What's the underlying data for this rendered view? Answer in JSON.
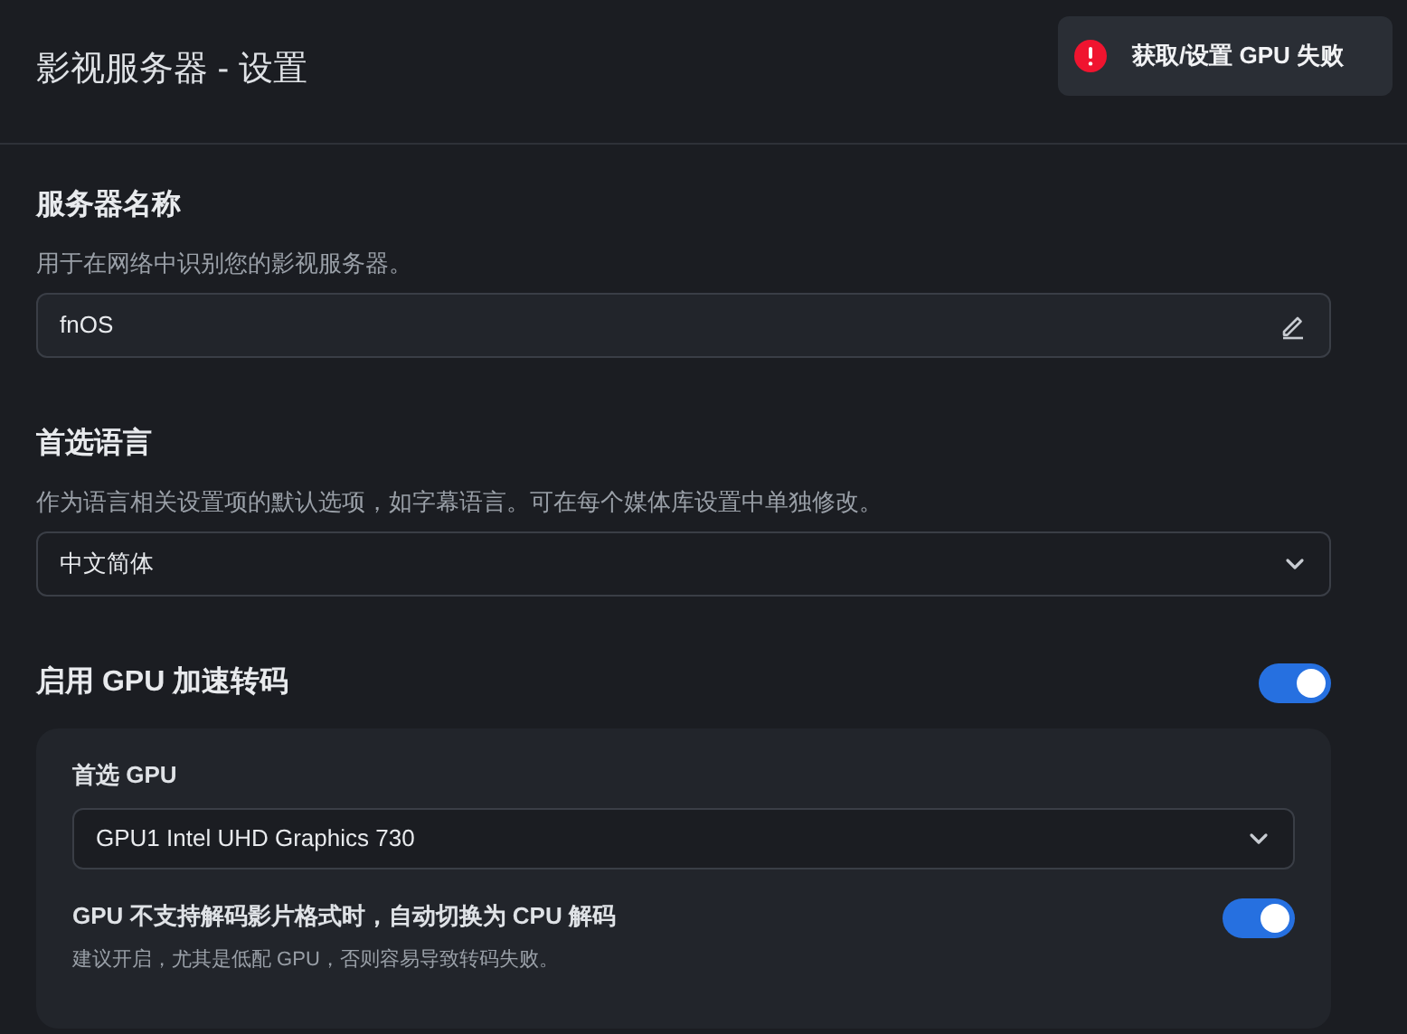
{
  "header": {
    "title": "影视服务器 - 设置"
  },
  "toast": {
    "message": "获取/设置 GPU 失败"
  },
  "sections": [
    {
      "kind": "text_input",
      "title": "服务器名称",
      "description": "用于在网络中识别您的影视服务器。",
      "value": "fnOS"
    },
    {
      "kind": "select",
      "title": "首选语言",
      "description": "作为语言相关设置项的默认选项，如字幕语言。可在每个媒体库设置中单独修改。",
      "value": "中文简体"
    },
    {
      "kind": "toggle",
      "title": "启用 GPU 加速转码",
      "on": true,
      "panel": {
        "label": "首选 GPU",
        "select_value": "GPU1 Intel UHD Graphics 730",
        "option": {
          "title": "GPU 不支持解码影片格式时，自动切换为 CPU 解码",
          "description": "建议开启，尤其是低配 GPU，否则容易导致转码失败。",
          "on": true
        }
      }
    }
  ]
}
